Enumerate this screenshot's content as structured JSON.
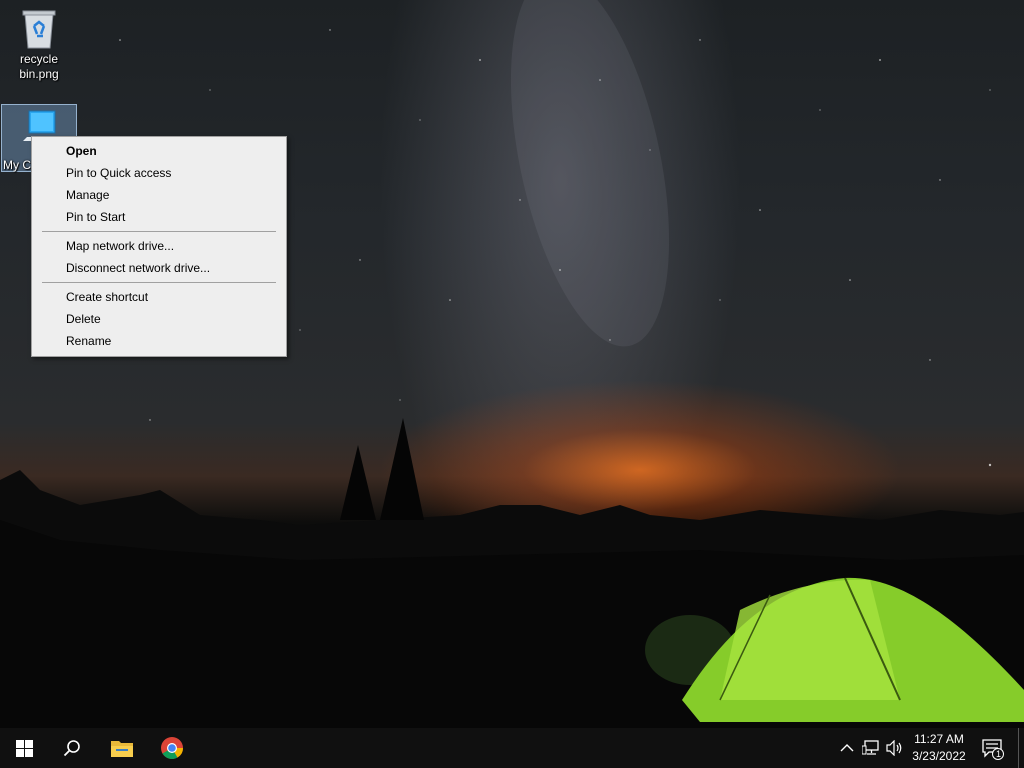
{
  "desktop": {
    "icons": [
      {
        "label": "recycle bin.png",
        "icon": "recycle-bin-icon"
      },
      {
        "label": "My Computer",
        "label_visible": "My C",
        "icon": "computer-icon"
      }
    ]
  },
  "context_menu": {
    "groups": [
      [
        "Open",
        "Pin to Quick access",
        "Manage",
        "Pin to Start"
      ],
      [
        "Map network drive...",
        "Disconnect network drive..."
      ],
      [
        "Create shortcut",
        "Delete",
        "Rename"
      ]
    ],
    "default_item": "Open"
  },
  "taskbar": {
    "pinned": [
      {
        "name": "start-button",
        "icon": "windows-logo-icon"
      },
      {
        "name": "search-button",
        "icon": "search-icon"
      },
      {
        "name": "file-explorer-button",
        "icon": "folder-icon"
      },
      {
        "name": "chrome-button",
        "icon": "chrome-icon"
      }
    ],
    "tray": {
      "icons": [
        "chevron-up-icon",
        "network-icon",
        "volume-icon"
      ],
      "time": "11:27 AM",
      "date": "3/23/2022",
      "notification_count": "1"
    }
  },
  "colors": {
    "taskbar": "#101010",
    "menu_background": "#eeeeee",
    "selection": "#7aa0c8",
    "tent": "#9be03a"
  }
}
